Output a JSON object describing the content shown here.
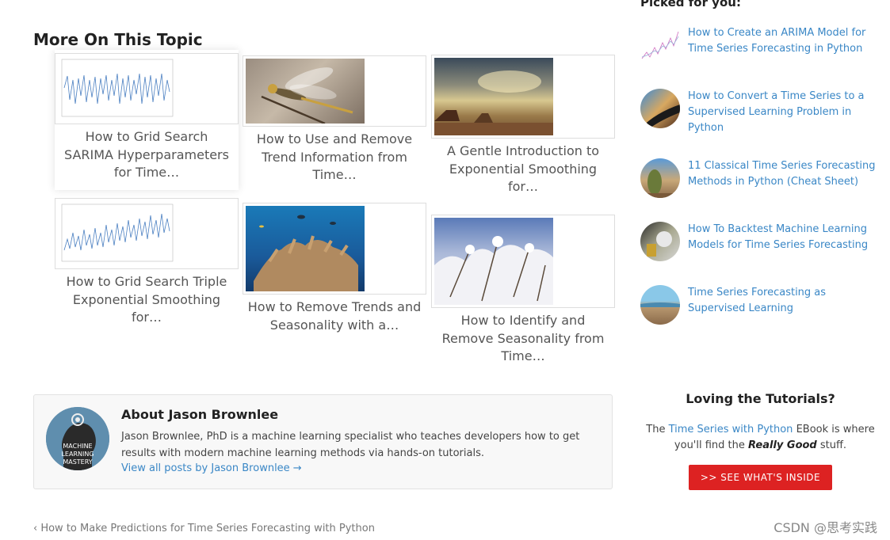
{
  "main": {
    "section_title": "More On This Topic",
    "related_posts": [
      {
        "title": "How to Grid Search SARIMA Hyperparameters for Time…",
        "image_icon": "line-chart-thumb-icon"
      },
      {
        "title": "How to Use and Remove Trend Information from Time…",
        "image_icon": "dragonfly-photo-icon"
      },
      {
        "title": "A Gentle Introduction to Exponential Smoothing for…",
        "image_icon": "desert-sky-photo-icon"
      },
      {
        "title": "How to Grid Search Triple Exponential Smoothing for…",
        "image_icon": "line-chart-thumb-icon"
      },
      {
        "title": "How to Remove Trends and Seasonality with a…",
        "image_icon": "coral-reef-photo-icon"
      },
      {
        "title": "How to Identify and Remove Seasonality from Time…",
        "image_icon": "snowy-branches-photo-icon"
      }
    ],
    "author": {
      "heading": "About Jason Brownlee",
      "bio": "Jason Brownlee, PhD is a machine learning specialist who teaches developers how to get results with modern machine learning methods via hands-on tutorials.",
      "link": "View all posts by Jason Brownlee →",
      "avatar_text": [
        "MACHINE",
        "LEARNING",
        "MASTERY"
      ]
    },
    "prev_post": "‹ How to Make Predictions for Time Series Forecasting with Python"
  },
  "sidebar": {
    "picked_title": "Picked for you:",
    "picked_items": [
      {
        "title": "How to Create an ARIMA Model for Time Series Forecasting in Python"
      },
      {
        "title": "How to Convert a Time Series to a Supervised Learning Problem in Python"
      },
      {
        "title": "11 Classical Time Series Forecasting Methods in Python (Cheat Sheet)"
      },
      {
        "title": "How To Backtest Machine Learning Models for Time Series Forecasting"
      },
      {
        "title": "Time Series Forecasting as Supervised Learning"
      }
    ],
    "promo": {
      "title": "Loving the Tutorials?",
      "text_before": "The ",
      "link": "Time Series with Python",
      "text_middle": " EBook is where you'll find the ",
      "emphasis": "Really Good",
      "text_after": " stuff.",
      "button": ">> SEE WHAT'S INSIDE"
    }
  },
  "watermark": "CSDN @思考实践",
  "colors": {
    "link": "#3a87c6",
    "button": "#dd2222"
  }
}
